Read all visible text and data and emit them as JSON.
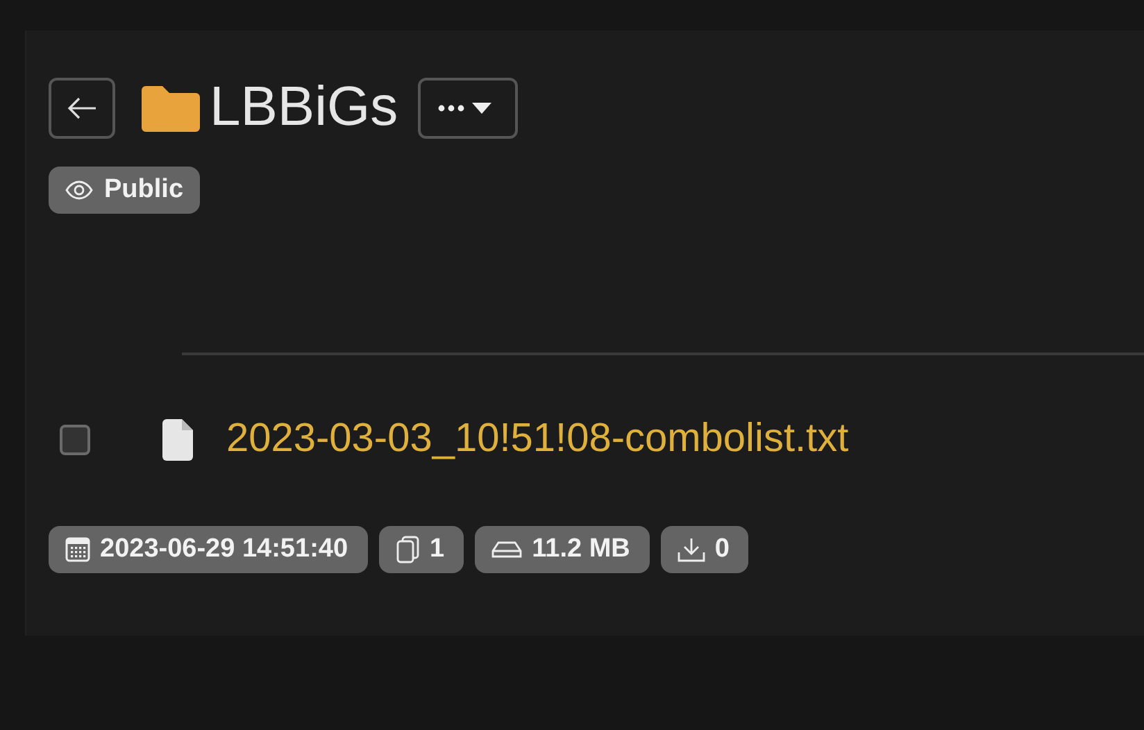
{
  "folder": {
    "name": "LBBiGs",
    "visibility": {
      "kind": "public",
      "label": "Public"
    }
  },
  "files": [
    {
      "name": "2023-03-03_10!51!08-combolist.txt",
      "checked": false
    }
  ],
  "stats": [
    {
      "kind": "date",
      "text": "2023-06-29 14:51:40"
    },
    {
      "kind": "files",
      "text": "1"
    },
    {
      "kind": "size",
      "text": "11.2 MB"
    },
    {
      "kind": "downloads",
      "text": "0"
    }
  ]
}
